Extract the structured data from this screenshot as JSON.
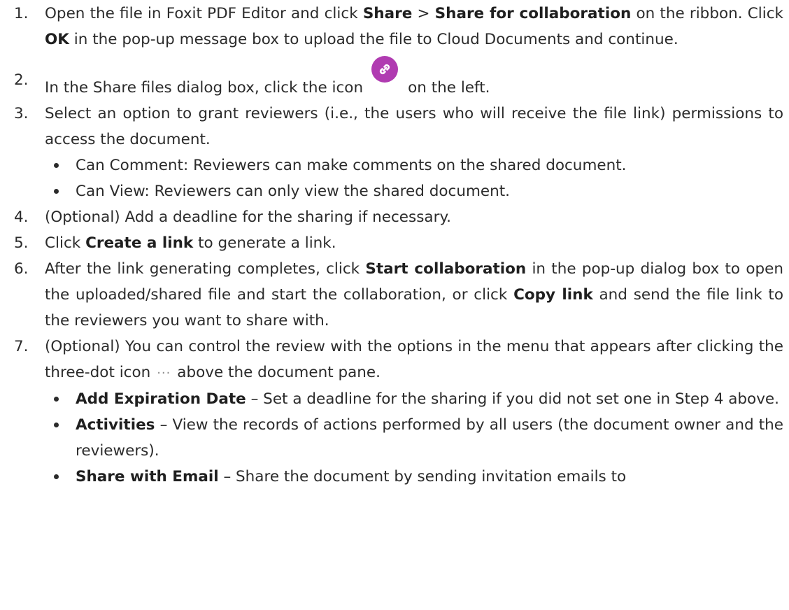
{
  "icons": {
    "link": "link-icon",
    "more": "three-dot-icon",
    "link_color": "#b03bb1"
  },
  "steps": [
    {
      "num": "1.",
      "parts": [
        "Open the file in Foxit PDF Editor and click ",
        "Share",
        " > ",
        "Share for collaboration",
        " on the ribbon. Click ",
        "OK",
        " in the pop-up message box to upload the file to Cloud Documents and continue."
      ]
    },
    {
      "num": "2.",
      "parts": [
        "In the Share files dialog box, click the icon",
        "on the left."
      ]
    },
    {
      "num": "3.",
      "text": "Select an option to grant reviewers (i.e., the users who will receive the file link) permissions to access the document.",
      "bullets": [
        "Can Comment: Reviewers can make comments on the shared document.",
        "Can View: Reviewers can only view the shared document."
      ]
    },
    {
      "num": "4.",
      "text": "(Optional) Add a deadline for the sharing if necessary."
    },
    {
      "num": "5.",
      "parts": [
        "Click ",
        "Create a link",
        " to generate a link."
      ]
    },
    {
      "num": "6.",
      "parts": [
        "After the link generating completes, click ",
        "Start collaboration",
        " in the pop-up dialog box to open the uploaded/shared file and start the collaboration, or click ",
        "Copy link",
        " and send the file link to the reviewers you want to share with."
      ]
    },
    {
      "num": "7.",
      "parts": [
        "(Optional) You can control the review with the options in the menu that appears after clicking the three-dot icon",
        "above the document pane."
      ],
      "bullets": [
        {
          "term": "Add Expiration Date",
          "desc": " – Set a deadline for the sharing if you did not set one in Step 4 above."
        },
        {
          "term": "Activities",
          "desc": " – View the records of actions performed by all users (the document owner and the reviewers)."
        },
        {
          "term": "Share with Email",
          "desc": " – Share the document by sending invitation emails to"
        }
      ]
    }
  ]
}
